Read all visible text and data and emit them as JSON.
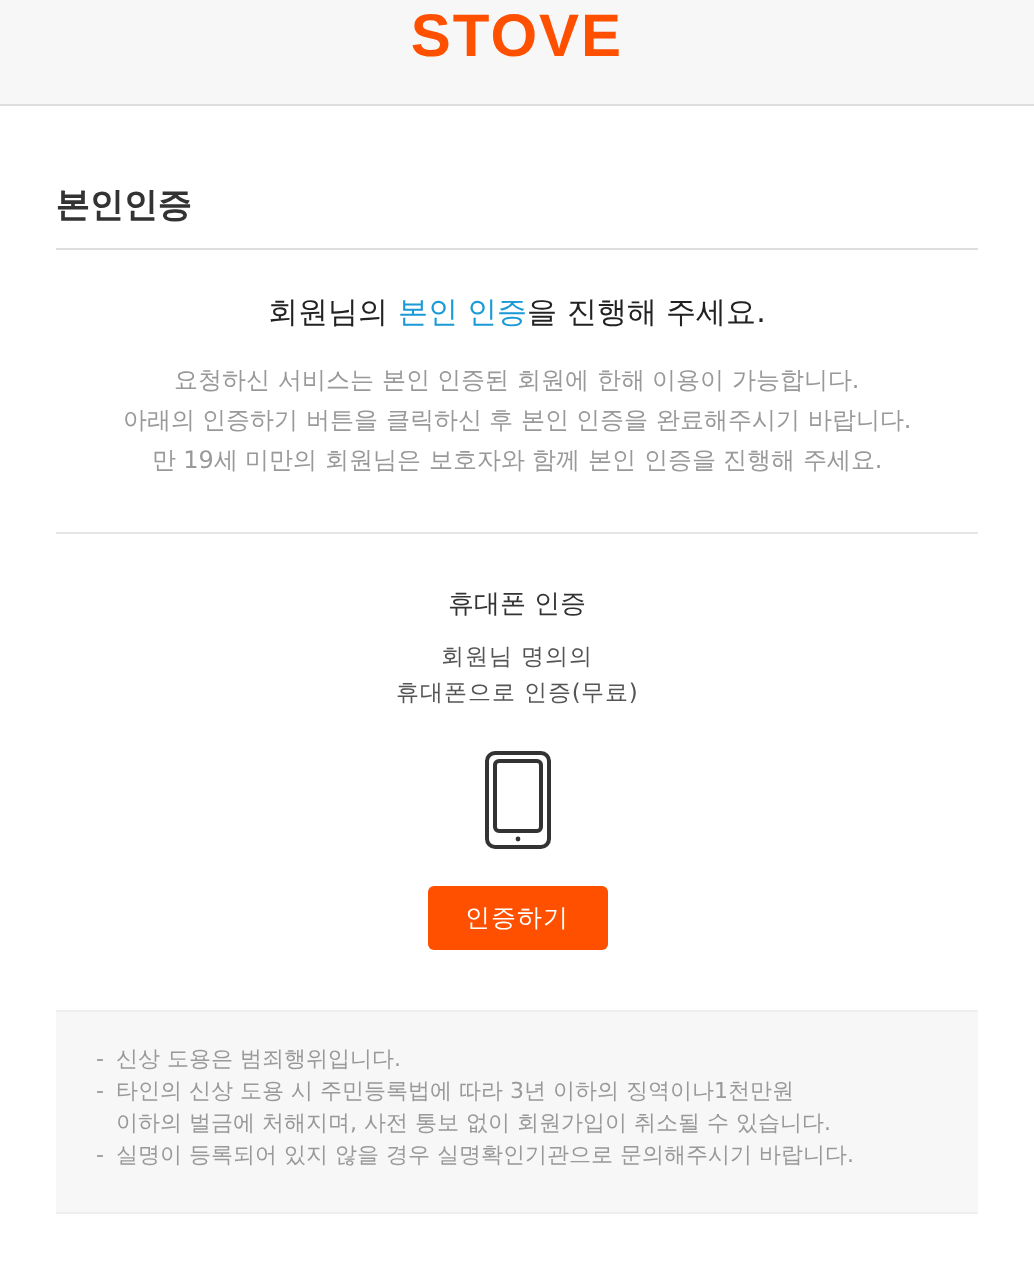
{
  "header": {
    "logo": "STOVE"
  },
  "page_title": "본인인증",
  "headline": [
    {
      "text": "회원님의 ",
      "highlight": false
    },
    {
      "text": "본인 인증",
      "highlight": true
    },
    {
      "text": "을 진행해 주세요.",
      "highlight": false
    }
  ],
  "description": [
    "요청하신 서비스는 본인 인증된 회원에 한해 이용이 가능합니다.",
    "아래의 인증하기 버튼을 클릭하신 후 본인 인증을 완료해주시기 바랍니다.",
    "만 19세 미만의 회원님은 보호자와 함께 본인 인증을 진행해 주세요."
  ],
  "method": {
    "title": "휴대폰 인증",
    "description": [
      "회원님 명의의",
      "휴대폰으로 인증(무료)"
    ],
    "button": "인증하기"
  },
  "notes": [
    {
      "bullet": "-",
      "lines": [
        "신상 도용은 범죄행위입니다."
      ]
    },
    {
      "bullet": "-",
      "lines": [
        "타인의 신상 도용 시 주민등록법에 따라 3년 이하의 징역이나1천만원",
        "이하의 벌금에 처해지며, 사전 통보 없이 회원가입이 취소될 수 있습니다."
      ]
    },
    {
      "bullet": "-",
      "lines": [
        "실명이 등록되어 있지 않을 경우 실명확인기관으로 문의해주시기 바랍니다."
      ]
    }
  ]
}
